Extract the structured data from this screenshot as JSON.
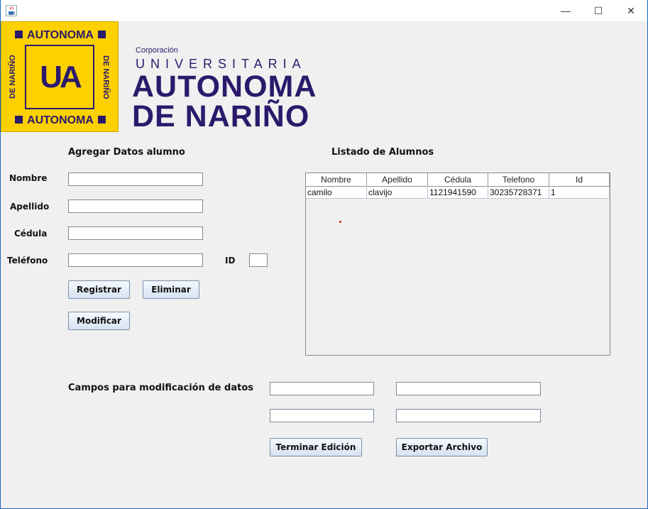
{
  "window": {
    "app_icon": "java-cup-icon",
    "controls": {
      "minimize": "—",
      "maximize": "☐",
      "close": "✕"
    }
  },
  "logo": {
    "top_text": "AUTONOMA",
    "bottom_text": "AUTONOMA",
    "left_side": "DE NARIÑO",
    "right_side": "DE NARIÑO",
    "monogram": "UA"
  },
  "brand": {
    "corporacion": "Corporación",
    "universitaria": "UNIVERSITARIA",
    "autonoma": "AUTONOMA",
    "narino": "DE NARIÑO",
    "color": "#2b1a6b",
    "logo_bg": "#fdd000"
  },
  "form": {
    "title": "Agregar Datos alumno",
    "nombre_label": "Nombre",
    "apellido_label": "Apellido",
    "cedula_label": "Cédula",
    "telefono_label": "Teléfono",
    "id_label": "ID",
    "nombre_value": "",
    "apellido_value": "",
    "cedula_value": "",
    "telefono_value": "",
    "id_value": "",
    "registrar": "Registrar",
    "eliminar": "Eliminar",
    "modificar": "Modificar"
  },
  "list": {
    "title": "Listado de Alumnos",
    "columns": [
      "Nombre",
      "Apellido",
      "Cédula",
      "Telefono",
      "Id"
    ],
    "rows": [
      [
        "camilo",
        "clavijo",
        "1121941590",
        "30235728371",
        "1"
      ]
    ]
  },
  "edit": {
    "title": "Campos para modificación de datos",
    "field1": "",
    "field2": "",
    "field3": "",
    "field4": "",
    "terminar": "Terminar Edición",
    "exportar": "Exportar Archivo"
  }
}
